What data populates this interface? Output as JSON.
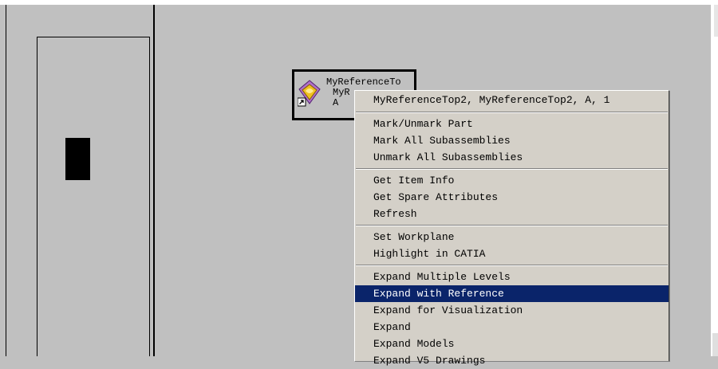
{
  "tree_node": {
    "lines": [
      "MyReferenceTo",
      "MyR",
      "A"
    ],
    "icon": "catia-part-icon",
    "overlay_icon": "shortcut-arrow-icon"
  },
  "context_menu": {
    "header": "MyReferenceTop2, MyReferenceTop2, A, 1",
    "groups": [
      [
        "Mark/Unmark Part",
        "Mark All Subassemblies",
        "Unmark All Subassemblies"
      ],
      [
        "Get Item Info",
        "Get Spare Attributes",
        "Refresh"
      ],
      [
        "Set Workplane",
        "Highlight in CATIA"
      ],
      [
        "Expand Multiple Levels",
        "Expand with Reference",
        "Expand for Visualization",
        "Expand",
        "Expand Models",
        "Expand V5 Drawings"
      ]
    ],
    "highlighted": "Expand with Reference"
  },
  "colors": {
    "background": "#c0c0c0",
    "menu_background": "#d4d0c8",
    "highlight": "#0a246a"
  }
}
